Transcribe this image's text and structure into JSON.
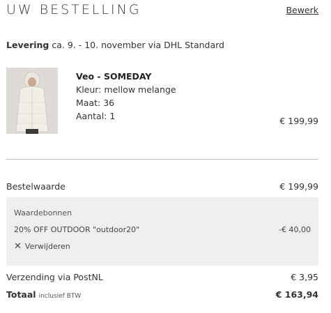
{
  "header": {
    "title": "UW BESTELLING",
    "edit_label": "Bewerk"
  },
  "delivery": {
    "label": "Levering",
    "text": "ca. 9. - 10. november via DHL Standard"
  },
  "product": {
    "name": "Veo - SOMEDAY",
    "color": "Kleur: mellow melange",
    "size": "Maat: 36",
    "quantity": "Aantal: 1",
    "price": "€ 199,99"
  },
  "summary": {
    "order_value_label": "Bestelwaarde",
    "order_value": "€ 199,99",
    "voucher": {
      "title": "Waardebonnen",
      "code": "20% OFF OUTDOOR \"outdoor20\"",
      "amount": "-€ 40,00",
      "remove_label": "Verwijderen"
    },
    "shipping_label": "Verzending via PostNL",
    "shipping_value": "€ 3,95",
    "total_label": "Totaal",
    "total_note": "inclusief BTW",
    "total_value": "€ 163,94"
  }
}
